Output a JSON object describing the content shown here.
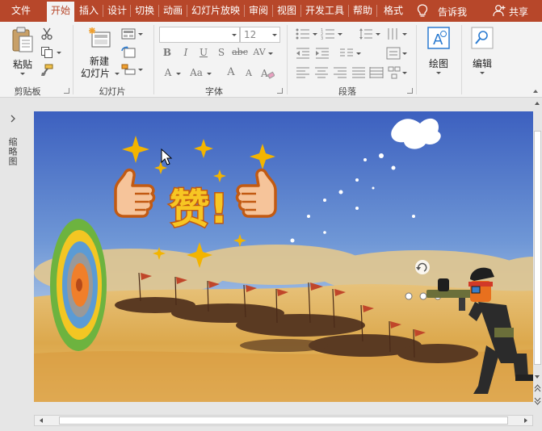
{
  "tabs": [
    {
      "label": "文件",
      "active": false
    },
    {
      "label": "开始",
      "active": true
    },
    {
      "label": "插入",
      "active": false
    },
    {
      "label": "设计",
      "active": false
    },
    {
      "label": "切换",
      "active": false
    },
    {
      "label": "动画",
      "active": false
    },
    {
      "label": "幻灯片放映",
      "active": false
    },
    {
      "label": "审阅",
      "active": false
    },
    {
      "label": "视图",
      "active": false
    },
    {
      "label": "开发工具",
      "active": false
    },
    {
      "label": "帮助",
      "active": false
    },
    {
      "label": "格式",
      "active": false
    }
  ],
  "tell_me": {
    "label": "告诉我",
    "icon": "lightbulb-icon"
  },
  "share": {
    "label": "共享",
    "icon": "person-plus-icon"
  },
  "ribbon": {
    "clipboard": {
      "paste_label": "粘贴",
      "group_label": "剪贴板"
    },
    "slides": {
      "new_slide_line1": "新建",
      "new_slide_line2": "幻灯片",
      "group_label": "幻灯片"
    },
    "font": {
      "font_name": "",
      "font_size": "12",
      "group_label": "字体",
      "bold": "B",
      "italic": "I",
      "underline": "U",
      "strike": "S",
      "abc": "abc",
      "av": "AV",
      "aa": "Aa",
      "a": "A"
    },
    "paragraph": {
      "group_label": "段落"
    },
    "drawing": {
      "label": "绘图"
    },
    "editing": {
      "label": "编辑"
    }
  },
  "thumbnail_pane": {
    "label": "缩略图"
  },
  "slide": {
    "praise_text": "赞!",
    "colors": {
      "ribbon": "#b7472a",
      "sky_top": "#3d63c0",
      "sky_bottom": "#a9c7e6",
      "sand": "#d9a64a",
      "target_green": "#6db33f",
      "target_yellow": "#f3c623",
      "target_blue": "#5b9bd5"
    }
  }
}
